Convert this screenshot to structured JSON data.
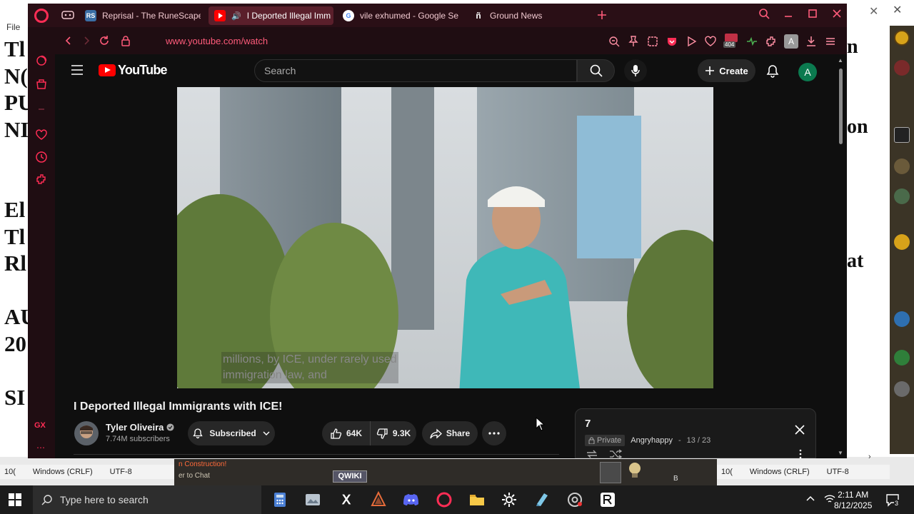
{
  "background_doc": {
    "menu": "File",
    "left_letters": [
      "Tl",
      "N(",
      "PU",
      "NI",
      "",
      "",
      "El",
      "Tl",
      "Rl",
      "",
      "AU",
      "20",
      "",
      "SI"
    ],
    "right_fragments": [
      {
        "text": "n"
      },
      {
        "text": "on"
      },
      {
        "text": "at"
      }
    ],
    "statusbar_left": {
      "col": "10(",
      "eol": "Windows (CRLF)",
      "enc": "UTF-8"
    },
    "statusbar_right": {
      "col": "10(",
      "eol": "Windows (CRLF)",
      "enc": "UTF-8"
    },
    "game_text_1": "n Construction!",
    "game_text_2": "er to Chat",
    "qwiki": "QWIKI",
    "game_b": "B"
  },
  "browser": {
    "tabs": [
      {
        "label": "Reprisal - The RuneScape",
        "icon": "RS",
        "icon_color": "#3a6ea5"
      },
      {
        "label": "I Deported Illegal Imm",
        "icon": "yt-play",
        "active": true
      },
      {
        "label": "vile exhumed - Google Se",
        "icon": "G"
      },
      {
        "label": "Ground News",
        "icon": "GN"
      }
    ],
    "url": "www.youtube.com/watch",
    "badge_404": "404",
    "profile_letter": "A",
    "accent": "#ff2d55"
  },
  "youtube": {
    "logo_text": "YouTube",
    "search_placeholder": "Search",
    "create_label": "Create",
    "avatar_letter": "A",
    "caption_lines": [
      "millions, by ICE, under rarely used",
      "immigration law, and"
    ],
    "video_title": "I Deported Illegal Immigrants with ICE!",
    "channel": {
      "name": "Tyler Oliveira",
      "subscribers": "7.74M subscribers"
    },
    "subscribed_label": "Subscribed",
    "likes": "64K",
    "dislikes": "9.3K",
    "share_label": "Share",
    "playlist": {
      "title": "7",
      "privacy": "Private",
      "owner": "Angryhappy",
      "position": "13 / 23"
    }
  },
  "taskbar": {
    "search_placeholder": "Type here to search",
    "time": "2:11 AM",
    "date": "8/12/2025",
    "notification_count": "3"
  }
}
